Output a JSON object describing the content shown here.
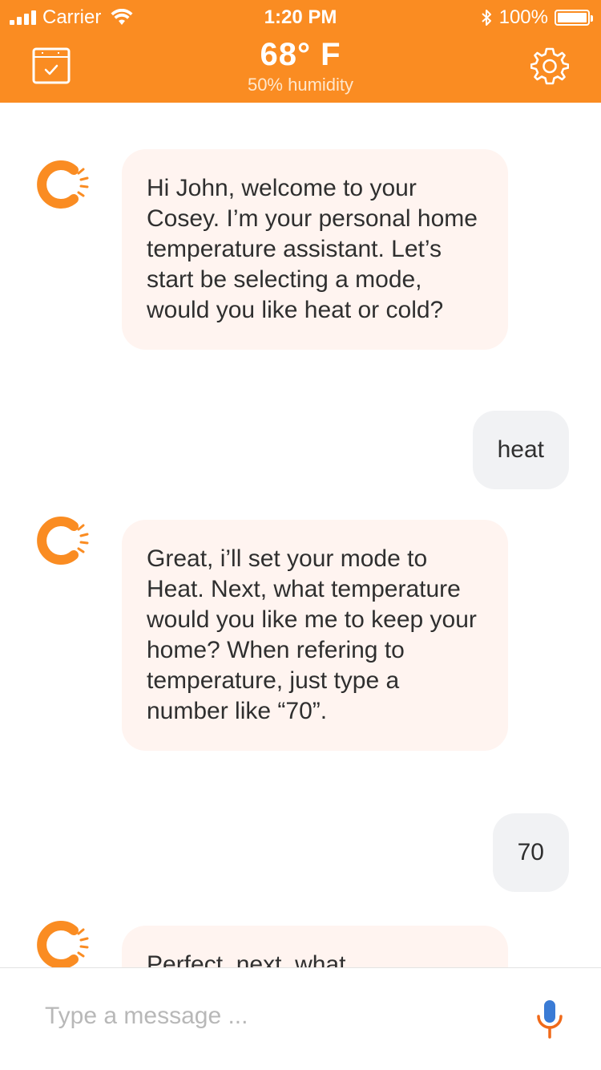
{
  "status_bar": {
    "carrier": "Carrier",
    "time": "1:20 PM",
    "battery": "100%"
  },
  "header": {
    "temperature": "68° F",
    "humidity": "50% humidity"
  },
  "chat": {
    "messages": [
      {
        "sender": "bot",
        "text": "Hi John, welcome to your Cosey. I’m your personal home temperature assistant. Let’s start be selecting a mode, would you like heat or cold?"
      },
      {
        "sender": "user",
        "text": "heat"
      },
      {
        "sender": "bot",
        "text": "Great, i’ll set your mode to Heat. Next, what temperature would you like me to keep your home? When refering to temperature, just type a number like “70”."
      },
      {
        "sender": "user",
        "text": "70"
      },
      {
        "sender": "bot",
        "text": "Perfect, next, what"
      }
    ]
  },
  "input": {
    "placeholder": "Type a message ..."
  },
  "colors": {
    "brand_orange": "#fa8c22",
    "bot_bubble": "#fff4f0",
    "user_bubble": "#f1f2f4",
    "mic_blue": "#3a7bd5",
    "mic_orange": "#f06a1a"
  },
  "icons": {
    "calendar": "calendar-check-icon",
    "settings": "gear-icon",
    "avatar": "cosey-logo-icon",
    "mic": "microphone-icon"
  }
}
